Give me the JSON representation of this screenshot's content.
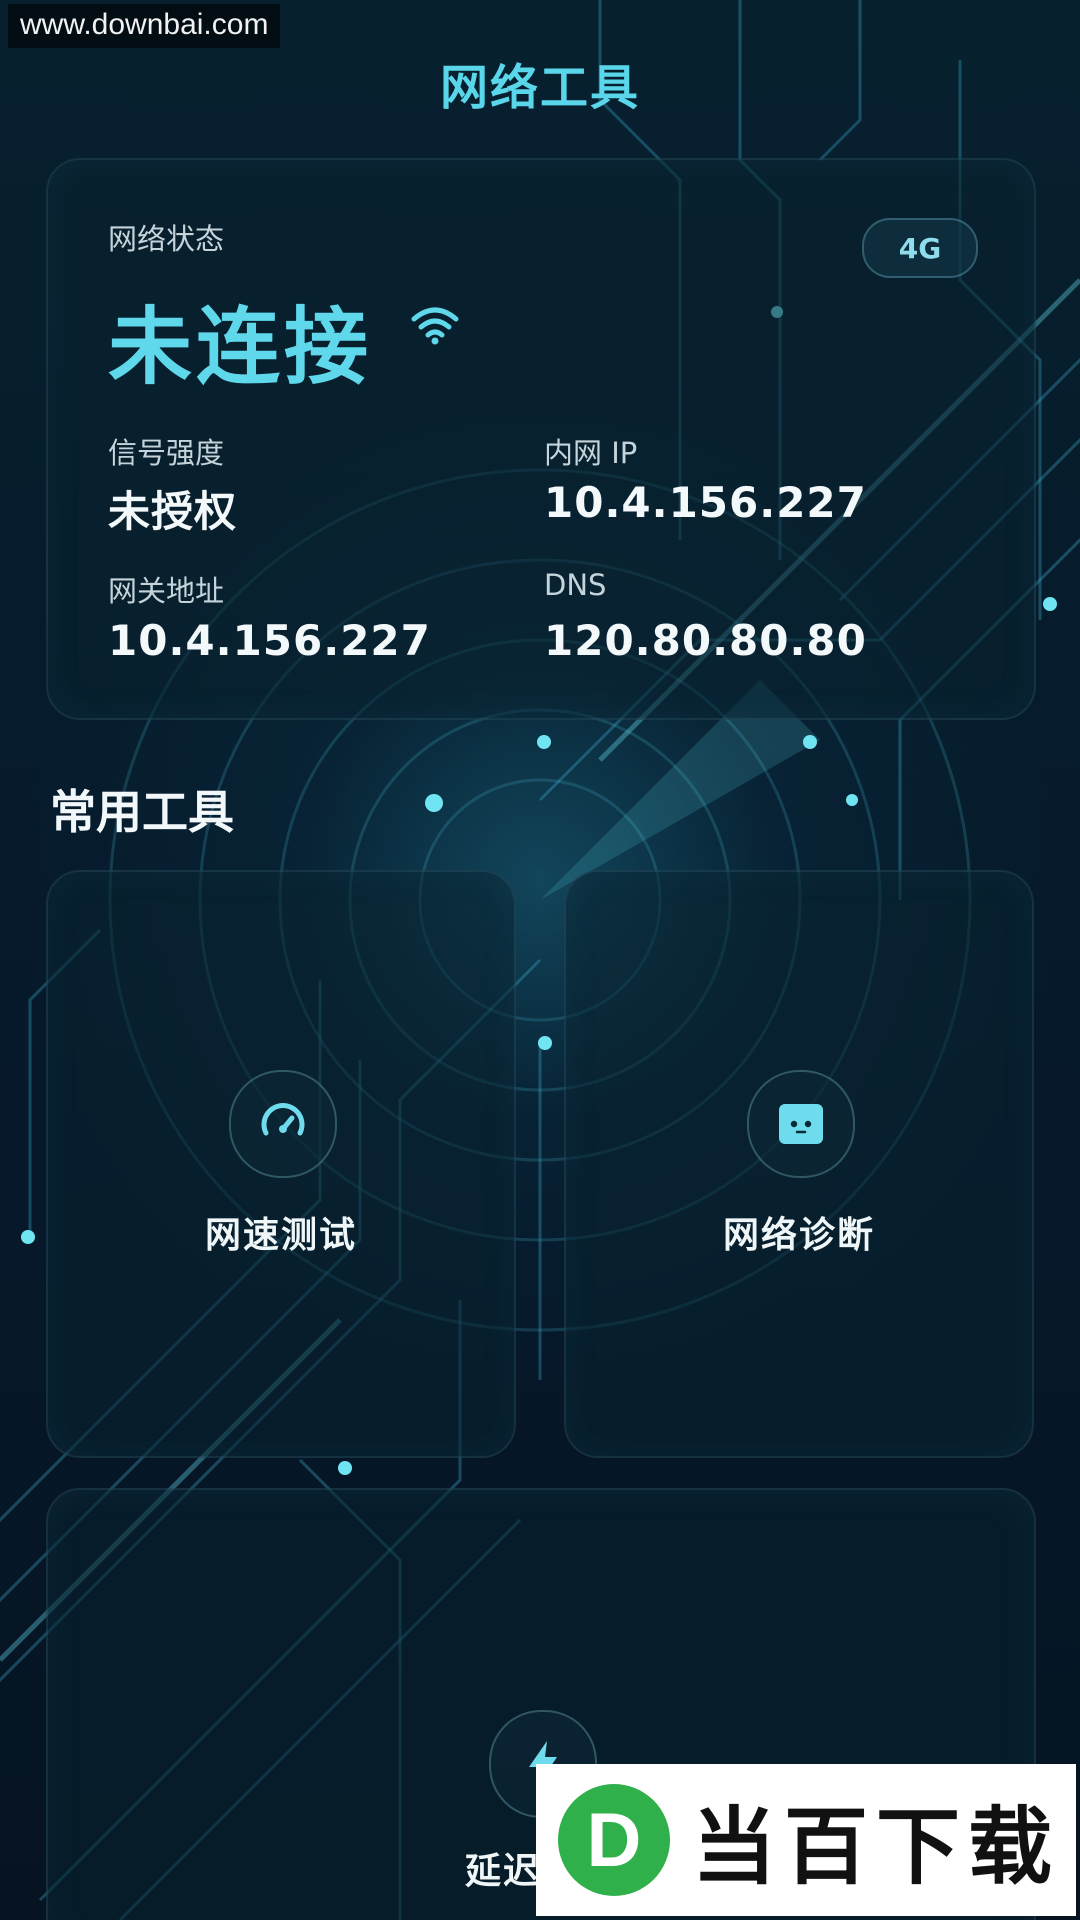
{
  "watermark_top": "www.downbai.com",
  "app_title": "网络工具",
  "status_card": {
    "section_label": "网络状态",
    "status": "未连接",
    "network_type": "4G",
    "signal_label": "信号强度",
    "signal_value": "未授权",
    "lan_ip_label": "内网 IP",
    "lan_ip_value": "10.4.156.227",
    "gateway_label": "网关地址",
    "gateway_value": "10.4.156.227",
    "dns_label": "DNS",
    "dns_value": "120.80.80.80"
  },
  "tools_section_title": "常用工具",
  "tools": [
    {
      "label": "网速测试",
      "icon": "speedometer-icon"
    },
    {
      "label": "网络诊断",
      "icon": "diagnosis-icon"
    },
    {
      "label": "延迟测试",
      "icon": "lightning-icon"
    }
  ],
  "watermark_logo": {
    "letter": "D",
    "text": "当百下载"
  },
  "colors": {
    "accent": "#59d6ea",
    "background": "#061826",
    "card": "#0a2230",
    "logo_green": "#2fb04a"
  }
}
